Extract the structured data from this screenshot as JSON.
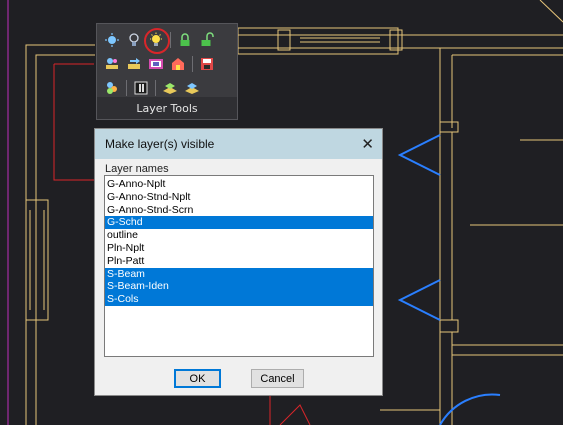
{
  "palette": {
    "title": "Layer Tools",
    "row1_icons": [
      "layer-isolate-icon",
      "layer-on-bulb-icon",
      "make-visible-bulb-icon",
      "layer-lock-icon",
      "layer-unlock-icon"
    ],
    "row2_icons": [
      "layer-match-icon",
      "layer-change-icon",
      "layer-freeze-vp-icon",
      "layer-merge-icon",
      "layer-save-icon"
    ],
    "row3_icons": [
      "layer-walk-icon",
      "layer-properties-icon",
      "layer-copy-icon",
      "layer-move-icon"
    ],
    "highlighted_icon": "make-visible-bulb-icon"
  },
  "dialog": {
    "title": "Make layer(s) visible",
    "list_label": "Layer names",
    "items": [
      {
        "name": "G-Anno-Nplt",
        "selected": false
      },
      {
        "name": "G-Anno-Stnd-Nplt",
        "selected": false
      },
      {
        "name": "G-Anno-Stnd-Scrn",
        "selected": false
      },
      {
        "name": "G-Schd",
        "selected": true
      },
      {
        "name": "outline",
        "selected": false
      },
      {
        "name": "Pln-Nplt",
        "selected": false
      },
      {
        "name": "Pln-Patt",
        "selected": false
      },
      {
        "name": "S-Beam",
        "selected": true
      },
      {
        "name": "S-Beam-Iden",
        "selected": true
      },
      {
        "name": "S-Cols",
        "selected": true
      }
    ],
    "ok_label": "OK",
    "cancel_label": "Cancel"
  },
  "colors": {
    "canvas_bg": "#1f1f23",
    "cad_lines": "#e6c47a",
    "cad_red": "#d8262a",
    "cad_blue": "#2a7fff",
    "selection": "#0078d7",
    "dialog_titlebar": "#bfd7e1"
  }
}
